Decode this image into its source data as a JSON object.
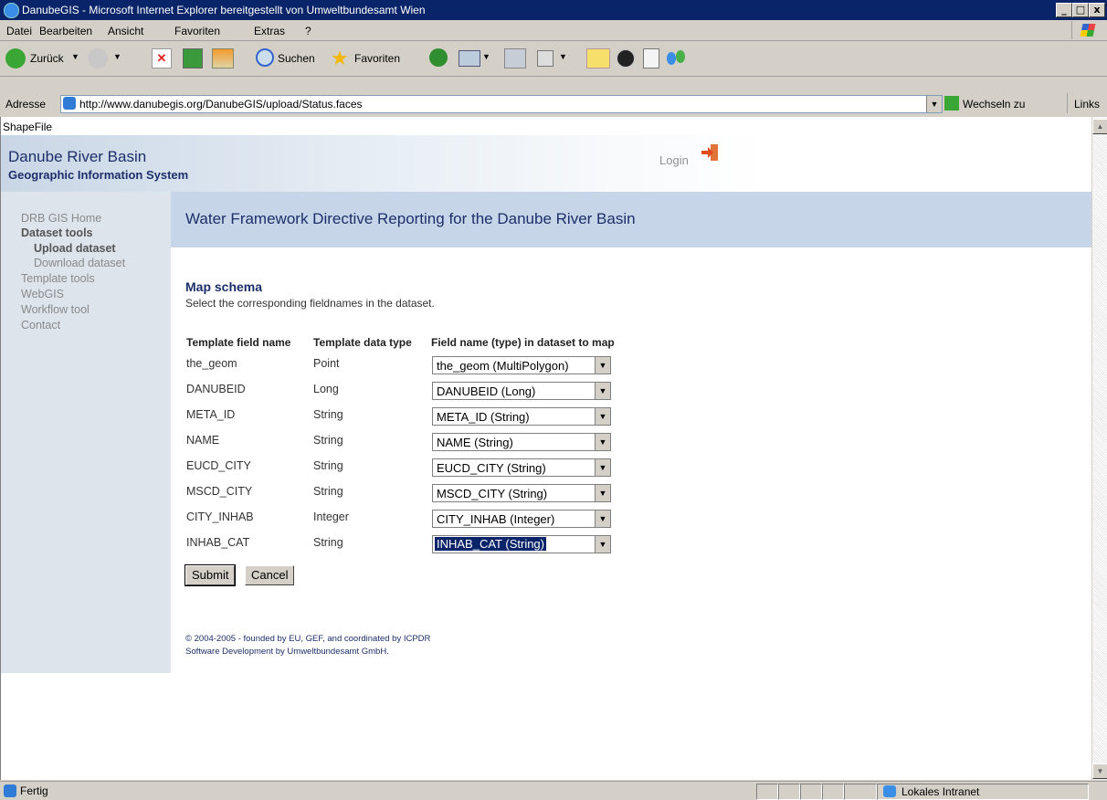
{
  "window": {
    "title": "DanubeGIS - Microsoft Internet Explorer bereitgestellt von Umweltbundesamt Wien",
    "buttons": [
      "_",
      "□",
      "x"
    ]
  },
  "menu": [
    "Datei",
    "Bearbeiten",
    "Ansicht",
    "Favoriten",
    "Extras",
    "?"
  ],
  "toolbar": {
    "back": "Zurück",
    "search": "Suchen",
    "favorites": "Favoriten"
  },
  "address": {
    "label": "Adresse",
    "url": "http://www.danubegis.org/DanubeGIS/upload/Status.faces",
    "go": "Wechseln zu",
    "links": "Links"
  },
  "page": {
    "top_label": "ShapeFile",
    "banner_title": "Danube River Basin",
    "banner_subtitle": "Geographic Information System",
    "login": "Login",
    "heading": "Water Framework Directive Reporting for the Danube River Basin",
    "sidebar": [
      {
        "label": "DRB GIS Home",
        "style": "normal"
      },
      {
        "label": "Dataset tools",
        "style": "bold"
      },
      {
        "label": "Upload dataset",
        "style": "bold-indent"
      },
      {
        "label": "Download dataset",
        "style": "indent"
      },
      {
        "label": "Template tools",
        "style": "normal"
      },
      {
        "label": "WebGIS",
        "style": "normal"
      },
      {
        "label": "Workflow tool",
        "style": "normal"
      },
      {
        "label": "Contact",
        "style": "normal"
      }
    ],
    "section_title": "Map schema",
    "section_subtitle": "Select the corresponding fieldnames in the dataset.",
    "columns": [
      "Template field name",
      "Template data type",
      "Field name (type) in dataset to map"
    ],
    "rows": [
      {
        "field": "the_geom",
        "type": "Point",
        "mapped": "the_geom (MultiPolygon)"
      },
      {
        "field": "DANUBEID",
        "type": "Long",
        "mapped": "DANUBEID (Long)"
      },
      {
        "field": "META_ID",
        "type": "String",
        "mapped": "META_ID (String)"
      },
      {
        "field": "NAME",
        "type": "String",
        "mapped": "NAME (String)"
      },
      {
        "field": "EUCD_CITY",
        "type": "String",
        "mapped": "EUCD_CITY (String)"
      },
      {
        "field": "MSCD_CITY",
        "type": "String",
        "mapped": "MSCD_CITY (String)"
      },
      {
        "field": "CITY_INHAB",
        "type": "Integer",
        "mapped": "CITY_INHAB (Integer)"
      },
      {
        "field": "INHAB_CAT",
        "type": "String",
        "mapped": "INHAB_CAT (String)"
      }
    ],
    "submit": "Submit",
    "cancel": "Cancel",
    "footer_line1": "© 2004-2005 - founded by EU, GEF, and coordinated by ICPDR",
    "footer_line2": "Software Development by Umweltbundesamt GmbH."
  },
  "status": {
    "left": "Fertig",
    "zone": "Lokales Intranet"
  }
}
